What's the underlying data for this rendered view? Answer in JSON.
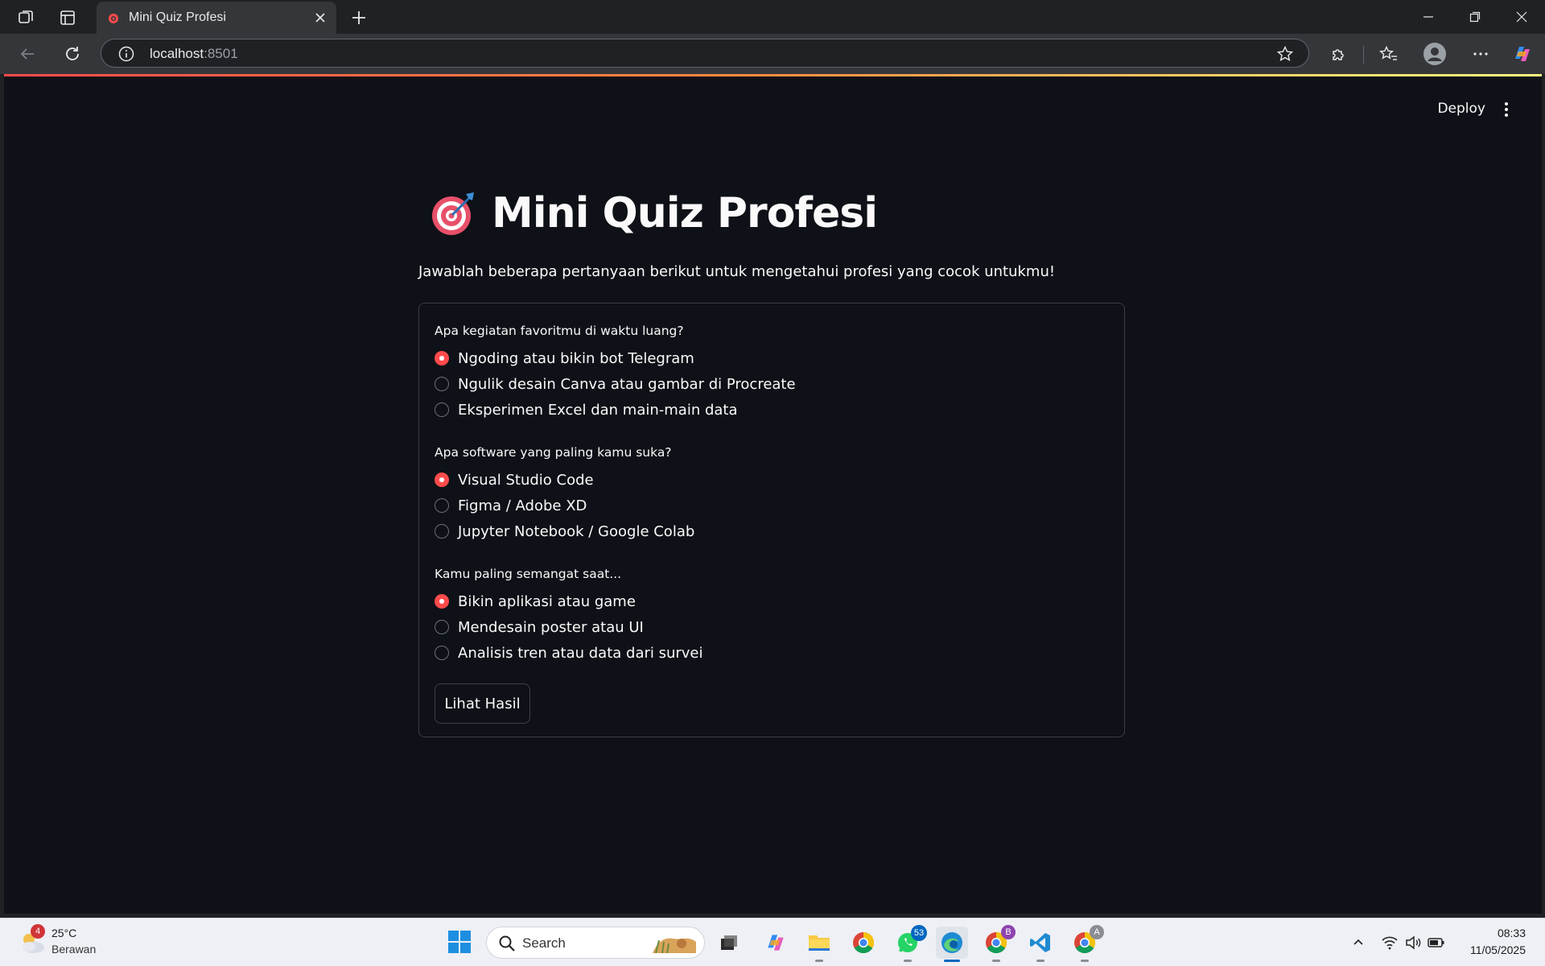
{
  "browser": {
    "tab": {
      "title": "Mini Quiz Profesi"
    },
    "address": {
      "host": "localhost",
      "port": ":8501"
    }
  },
  "app": {
    "toolbar": {
      "deploy_label": "Deploy"
    },
    "title": "Mini Quiz Profesi",
    "subtitle": "Jawablah beberapa pertanyaan berikut untuk mengetahui profesi yang cocok untukmu!",
    "questions": [
      {
        "label": "Apa kegiatan favoritmu di waktu luang?",
        "options": [
          "Ngoding atau bikin bot Telegram",
          "Ngulik desain Canva atau gambar di Procreate",
          "Eksperimen Excel dan main-main data"
        ],
        "selected_index": 0
      },
      {
        "label": "Apa software yang paling kamu suka?",
        "options": [
          "Visual Studio Code",
          "Figma / Adobe XD",
          "Jupyter Notebook / Google Colab"
        ],
        "selected_index": 0
      },
      {
        "label": "Kamu paling semangat saat...",
        "options": [
          "Bikin aplikasi atau game",
          "Mendesain poster atau UI",
          "Analisis tren atau data dari survei"
        ],
        "selected_index": 0
      }
    ],
    "submit_label": "Lihat Hasil",
    "accent_color": "#ff4b4b"
  },
  "taskbar": {
    "weather": {
      "badge": "4",
      "temp": "25°C",
      "condition": "Berawan"
    },
    "search_label": "Search",
    "badges": {
      "whatsapp": "53",
      "chrome_b": "B",
      "chrome_a": "A"
    },
    "clock": {
      "time": "08:33",
      "date": "11/05/2025"
    }
  }
}
